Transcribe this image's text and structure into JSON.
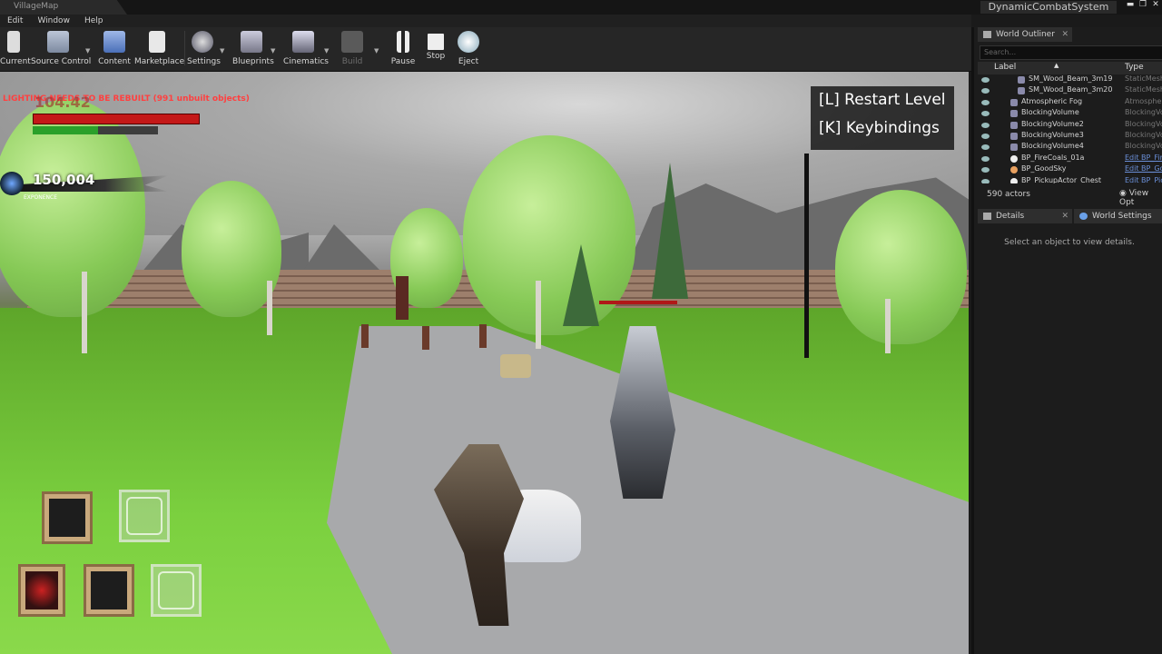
{
  "window": {
    "doc_tab": "VillageMap",
    "project_name": "DynamicCombatSystem",
    "controls": [
      "▬",
      "❐",
      "✕"
    ]
  },
  "menu": [
    "Edit",
    "Window",
    "Help"
  ],
  "toolbar": {
    "buttons": [
      {
        "label": "Current"
      },
      {
        "label": "Source Control"
      },
      {
        "label": "Content"
      },
      {
        "label": "Marketplace"
      },
      {
        "label": "Settings"
      },
      {
        "label": "Blueprints"
      },
      {
        "label": "Cinematics"
      },
      {
        "label": "Build"
      },
      {
        "label": "Pause"
      },
      {
        "label": "Stop"
      },
      {
        "label": "Eject"
      }
    ]
  },
  "viewport": {
    "lighting_warning": "LIGHTING NEEDS TO BE REBUILT (991 unbuilt objects)",
    "hp_value": "104.42",
    "stamina_fraction": 0.52,
    "souls": "150,004",
    "souls_caption": "EXPONENCE",
    "key_hints": [
      "[L] Restart Level",
      "[K] Keybindings"
    ]
  },
  "world_outliner": {
    "title": "World Outliner",
    "search_placeholder": "Search...",
    "col_label": "Label",
    "col_type": "Type",
    "rows": [
      {
        "label": "SM_Wood_Beam_3m19",
        "type": "StaticMeshA"
      },
      {
        "label": "SM_Wood_Beam_3m20",
        "type": "StaticMeshA"
      },
      {
        "label": "Atmospheric Fog",
        "type": "Atmospheric"
      },
      {
        "label": "BlockingVolume",
        "type": "BlockingVol"
      },
      {
        "label": "BlockingVolume2",
        "type": "BlockingVol"
      },
      {
        "label": "BlockingVolume3",
        "type": "BlockingVol"
      },
      {
        "label": "BlockingVolume4",
        "type": "BlockingVol"
      },
      {
        "label": "BP_FireCoals_01a",
        "type": "Edit BP_Fir"
      },
      {
        "label": "BP_GoodSky",
        "type": "Edit BP_Go"
      },
      {
        "label": "BP_PickupActor_Chest",
        "type": "Edit BP_Pic"
      }
    ],
    "actor_count": "590 actors",
    "view_options": "View Opt"
  },
  "details": {
    "tab": "Details",
    "world_settings_tab": "World Settings",
    "empty_message": "Select an object to view details."
  },
  "colors": {
    "editor_bg": "#262626",
    "hp_red": "#c41818",
    "stamina_green": "#2aa02a",
    "warning_red": "#ff4040",
    "link_blue": "#6a8fd8"
  }
}
